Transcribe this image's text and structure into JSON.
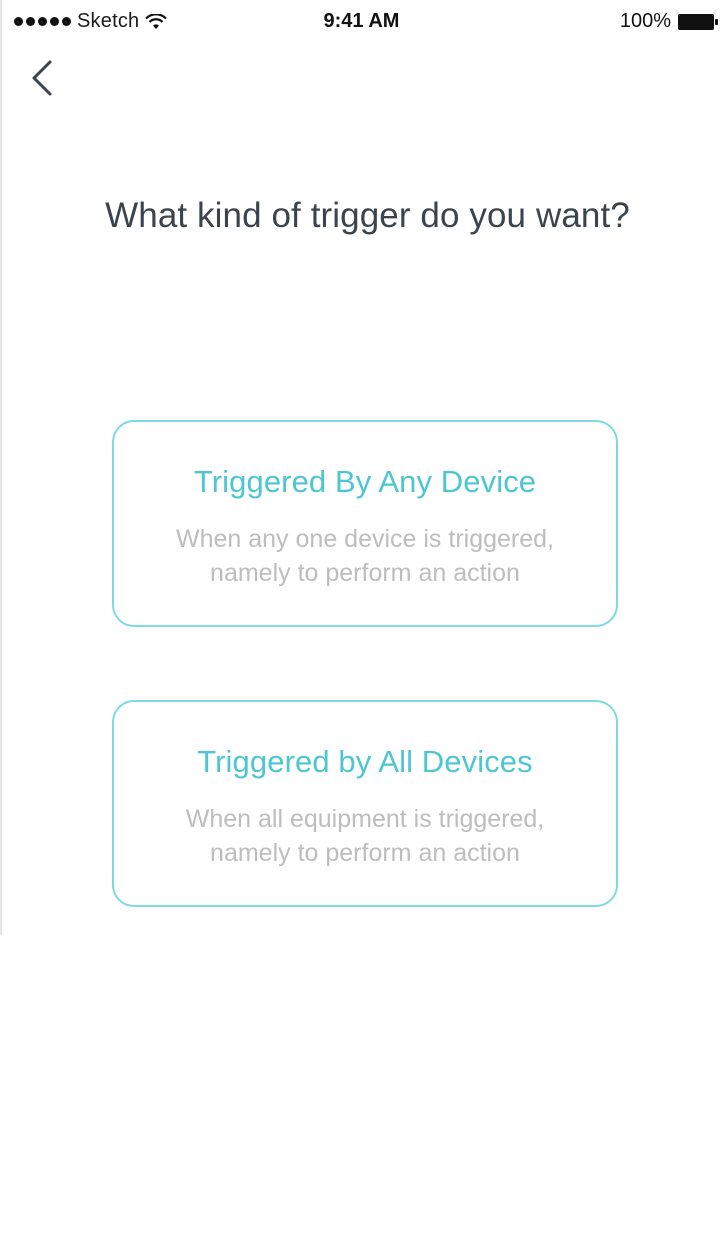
{
  "status_bar": {
    "carrier": "Sketch",
    "time": "9:41 AM",
    "battery": "100%"
  },
  "header": {
    "back_icon": "chevron-left-icon"
  },
  "page": {
    "title": "What kind of trigger do you want?"
  },
  "options": [
    {
      "title": "Triggered By Any Device",
      "description_line1": "When any one device is triggered,",
      "description_line2": "namely to perform an action"
    },
    {
      "title": "Triggered by All Devices",
      "description_line1": "When all equipment is triggered,",
      "description_line2": "namely to perform an action"
    }
  ],
  "colors": {
    "accent": "#4dc6d4",
    "card_border": "#7fd9e3",
    "title_text": "#3b444c",
    "description_text": "#bdbdbd"
  }
}
